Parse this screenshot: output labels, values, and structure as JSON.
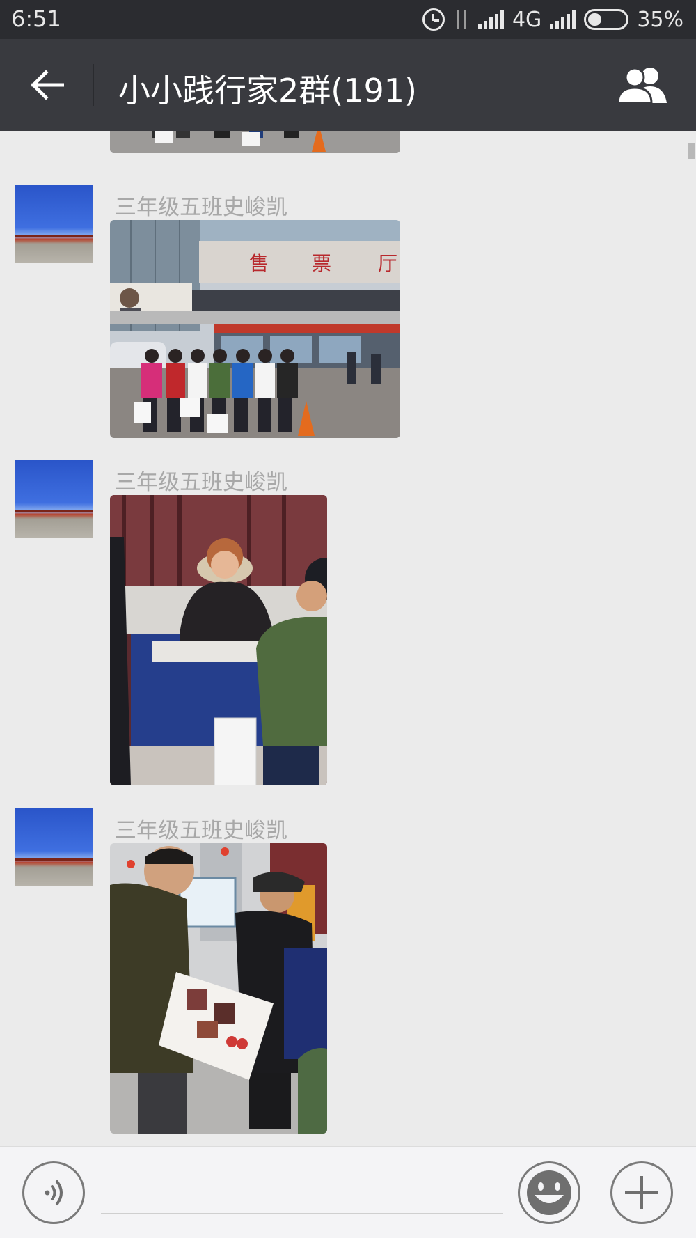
{
  "status_bar": {
    "time": "6:51",
    "network": "4G",
    "battery": "35%",
    "battery_level": 0.35
  },
  "header": {
    "title": "小小践行家2群(191)",
    "back_icon": "arrow-left-icon",
    "members_icon": "group-members-icon"
  },
  "messages": [
    {
      "sender": "",
      "type": "image"
    },
    {
      "sender": "三年级五班史峻凯",
      "type": "image"
    },
    {
      "sender": "三年级五班史峻凯",
      "type": "image"
    },
    {
      "sender": "三年级五班史峻凯",
      "type": "image"
    }
  ],
  "input_bar": {
    "voice_icon": "voice-icon",
    "emoji_icon": "emoji-icon",
    "more_icon": "plus-icon",
    "placeholder": ""
  },
  "colors": {
    "status_bar": "#2b2c30",
    "title_bar": "#393a3f",
    "chat_background": "#ebebeb",
    "sender_name": "#a8a8a8"
  }
}
